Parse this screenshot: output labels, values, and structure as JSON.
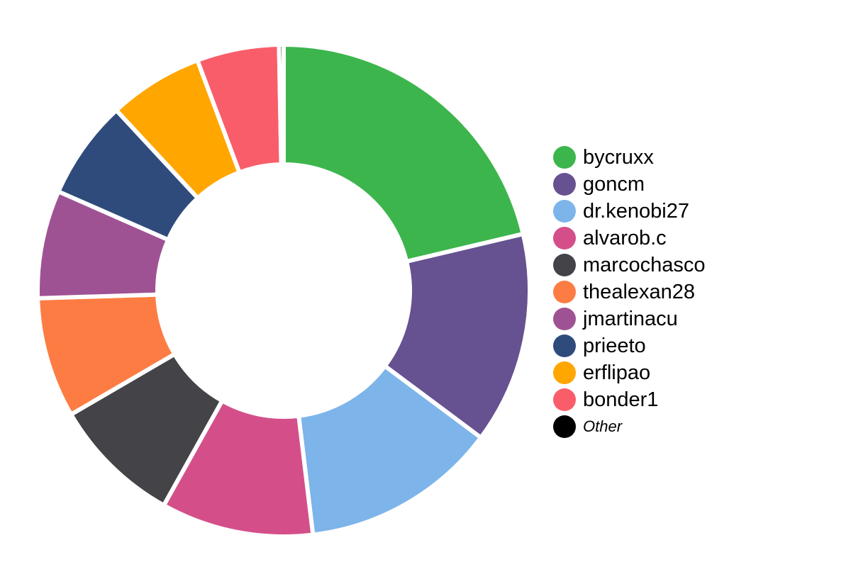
{
  "chart_data": {
    "type": "pie",
    "variant": "donut",
    "title": "",
    "legend_position": "right",
    "slices": [
      {
        "label": "bycruxx",
        "value": 21.3,
        "color": "#3db54d"
      },
      {
        "label": "goncm",
        "value": 13.9,
        "color": "#665191"
      },
      {
        "label": "dr.kenobi27",
        "value": 12.9,
        "color": "#7db4e9"
      },
      {
        "label": "alvarob.c",
        "value": 10.0,
        "color": "#d44f89"
      },
      {
        "label": "marcochasco",
        "value": 8.5,
        "color": "#444347"
      },
      {
        "label": "thealexan28",
        "value": 7.9,
        "color": "#fd7c43"
      },
      {
        "label": "jmartinacu",
        "value": 7.1,
        "color": "#9f5293"
      },
      {
        "label": "prieeto",
        "value": 6.5,
        "color": "#2f4b7c"
      },
      {
        "label": "erflipao",
        "value": 6.2,
        "color": "#ffa600"
      },
      {
        "label": "bonder1",
        "value": 5.4,
        "color": "#f95d6a"
      },
      {
        "label": "Other",
        "value": 0.3,
        "color": "#000000",
        "italic": true
      }
    ]
  }
}
